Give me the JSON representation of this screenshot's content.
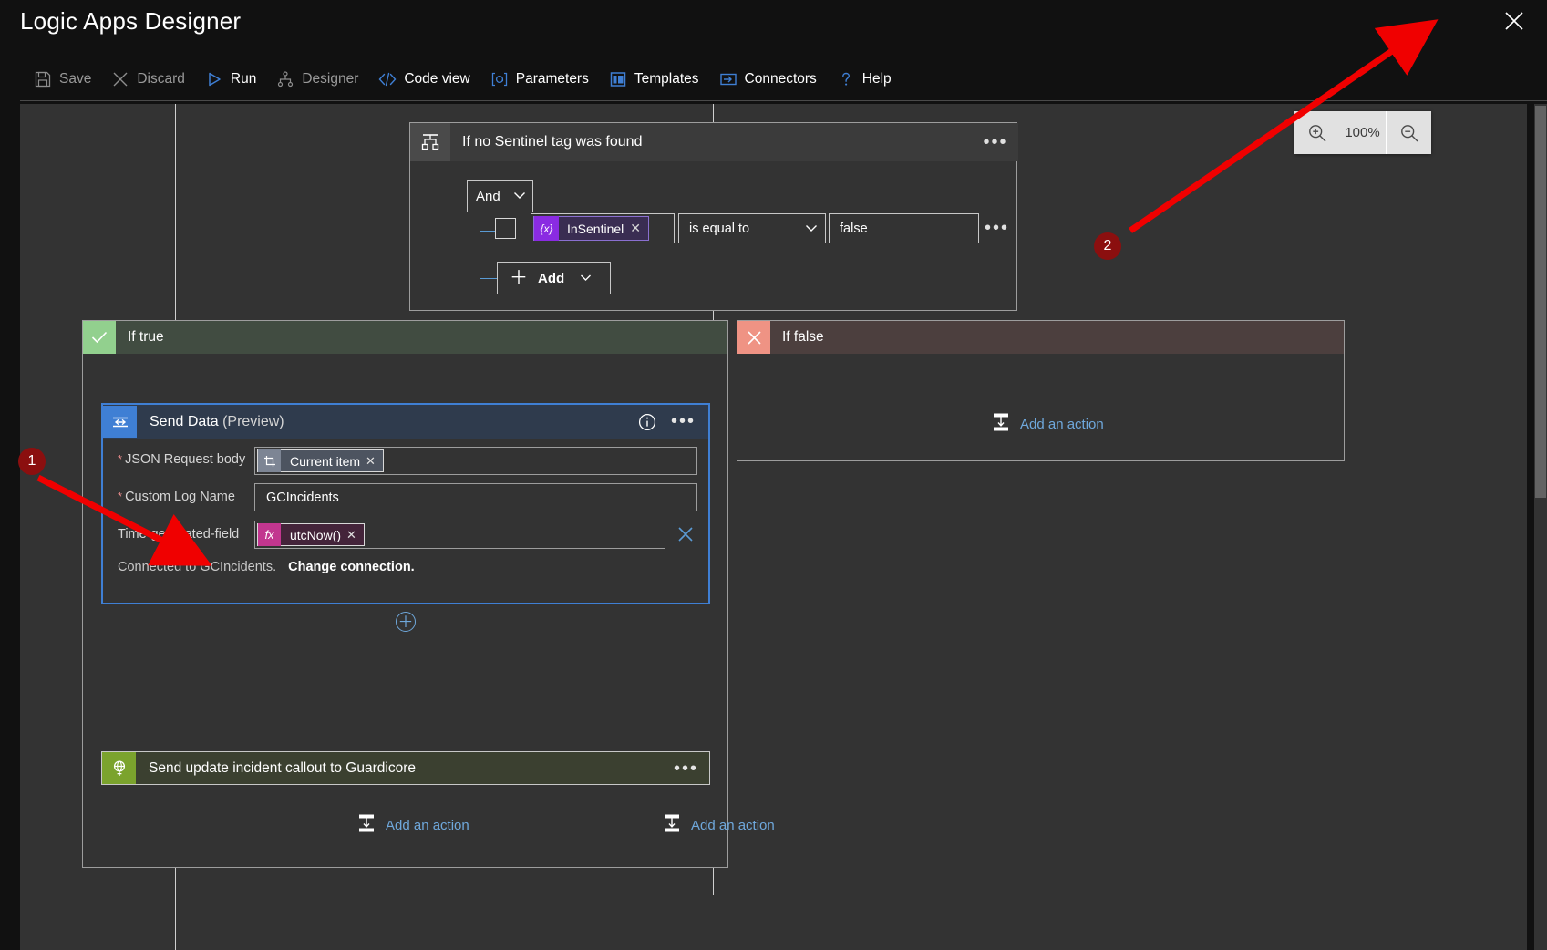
{
  "window": {
    "title": "Logic Apps Designer",
    "close_icon": "close-icon"
  },
  "toolbar": {
    "items": [
      {
        "label": "Save",
        "icon": "save-icon",
        "enabled": false
      },
      {
        "label": "Discard",
        "icon": "discard-x-icon",
        "enabled": false
      },
      {
        "label": "Run",
        "icon": "run-play-icon",
        "enabled": true
      },
      {
        "label": "Designer",
        "icon": "designer-icon",
        "enabled": false
      },
      {
        "label": "Code view",
        "icon": "code-view-icon",
        "enabled": true
      },
      {
        "label": "Parameters",
        "icon": "parameters-icon",
        "enabled": true
      },
      {
        "label": "Templates",
        "icon": "templates-icon",
        "enabled": true
      },
      {
        "label": "Connectors",
        "icon": "connectors-icon",
        "enabled": true
      },
      {
        "label": "Help",
        "icon": "help-icon",
        "enabled": true
      }
    ]
  },
  "zoom_control": {
    "zoom_in_icon": "zoom-in-icon",
    "level": "100%",
    "zoom_out_icon": "zoom-out-icon"
  },
  "condition": {
    "icon": "condition-icon",
    "title": "If no Sentinel tag was found",
    "ellipsis": "•••",
    "logic_operator": "And",
    "row": {
      "token": {
        "icon": "{x}",
        "label": "InSentinel",
        "remove": "✕"
      },
      "operator": "is equal to",
      "value": "false",
      "ellipsis": "•••"
    },
    "add_button": {
      "plus": "＋",
      "label": "Add"
    }
  },
  "branch_true": {
    "icon": "checkmark-icon",
    "label": "If true",
    "send_data": {
      "icon": "send-data-icon",
      "title": "Send Data",
      "title_suffix": "(Preview)",
      "info_icon": "info-icon",
      "ellipsis": "•••",
      "fields": [
        {
          "label": "JSON Request body",
          "required": true,
          "token": {
            "kind": "dynamic",
            "icon": "current-item-icon",
            "label": "Current item",
            "remove": "✕"
          }
        },
        {
          "label": "Custom Log Name",
          "required": true,
          "value": "GCIncidents"
        },
        {
          "label": "Time-generated-field",
          "required": false,
          "token": {
            "kind": "expression",
            "icon": "fx",
            "label": "utcNow()",
            "remove": "✕"
          },
          "clear_icon": "clear-x-icon"
        }
      ],
      "connection_text": "Connected to GCIncidents.",
      "change_connection": "Change connection."
    },
    "insert_plus": "＋",
    "guardicore": {
      "icon": "guardicore-globe-icon",
      "label": "Send update incident callout to Guardicore",
      "ellipsis": "•••"
    },
    "add_action": {
      "icon": "insert-action-icon",
      "label": "Add an action"
    }
  },
  "branch_false": {
    "icon": "cross-icon",
    "label": "If false",
    "add_action": {
      "icon": "insert-action-icon",
      "label": "Add an action"
    }
  },
  "footer": {
    "add_action": {
      "icon": "insert-action-icon",
      "label": "Add an action"
    }
  },
  "annotations": [
    {
      "number": "1"
    },
    {
      "number": "2"
    }
  ],
  "colors": {
    "accent_blue": "#3f7fd4",
    "link_blue": "#6fa8dc",
    "true_green": "#92d08e",
    "false_red": "#ef9384",
    "guardicore_green": "#7ba32d",
    "token_purple": "#8a2be2",
    "token_pink": "#c2368f",
    "annotation_red": "#8b0f0f",
    "arrow_red": "#f00000"
  }
}
